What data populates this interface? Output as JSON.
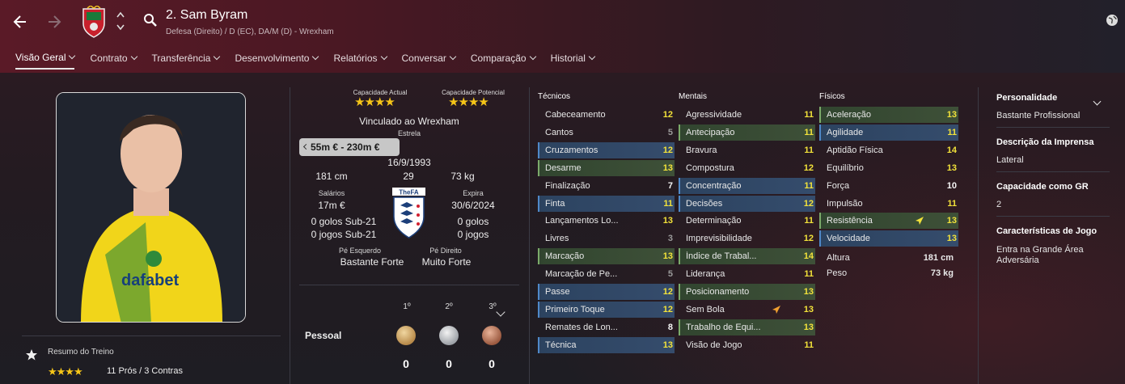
{
  "header": {
    "player_title": "2. Sam Byram",
    "subtitle": "Defesa (Direito) / D (EC), DA/M (D) - Wrexham"
  },
  "tabs": [
    {
      "label": "Visão Geral"
    },
    {
      "label": "Contrato"
    },
    {
      "label": "Transferência"
    },
    {
      "label": "Desenvolvimento"
    },
    {
      "label": "Relatórios"
    },
    {
      "label": "Conversar"
    },
    {
      "label": "Comparação"
    },
    {
      "label": "Historial"
    }
  ],
  "training": {
    "label": "Resumo do Treino",
    "stars": "★★★★",
    "summary": "11 Prós / 3 Contras"
  },
  "info": {
    "cap_actual_label": "Capacidade Actual",
    "cap_actual_stars": "★★★★",
    "cap_potencial_label": "Capacidade Potencial",
    "cap_potencial_stars": "★★★★",
    "contract_status": "Vinculado ao Wrexham",
    "reputation": "Estrela",
    "value": "55m € - 230m €",
    "dob": "16/9/1993",
    "height": "181 cm",
    "age": "29",
    "weight": "73 kg",
    "wage_label": "Salários",
    "wage": "17m €",
    "expires_label": "Expira",
    "expires": "30/6/2024",
    "u21_goals_left": "0 golos Sub-21",
    "u21_games_left": "0 jogos Sub-21",
    "goals_right": "0 golos",
    "games_right": "0 jogos",
    "left_foot_label": "Pé Esquerdo",
    "left_foot": "Bastante Forte",
    "right_foot_label": "Pé Direito",
    "right_foot": "Muito Forte",
    "fa_label": "TheFA"
  },
  "awards": {
    "row_label": "Pessoal",
    "cols": [
      "1º",
      "2º",
      "3º"
    ],
    "values": [
      "0",
      "0",
      "0"
    ]
  },
  "tecnicos": {
    "title": "Técnicos",
    "rows": [
      {
        "label": "Cabeceamento",
        "value": "12"
      },
      {
        "label": "Cantos",
        "value": "5"
      },
      {
        "label": "Cruzamentos",
        "value": "12"
      },
      {
        "label": "Desarme",
        "value": "13"
      },
      {
        "label": "Finalização",
        "value": "7"
      },
      {
        "label": "Finta",
        "value": "11"
      },
      {
        "label": "Lançamentos Lo...",
        "value": "13"
      },
      {
        "label": "Livres",
        "value": "3"
      },
      {
        "label": "Marcação",
        "value": "13"
      },
      {
        "label": "Marcação de Pe...",
        "value": "5"
      },
      {
        "label": "Passe",
        "value": "12"
      },
      {
        "label": "Primeiro Toque",
        "value": "12"
      },
      {
        "label": "Remates de Lon...",
        "value": "8"
      },
      {
        "label": "Técnica",
        "value": "13"
      }
    ]
  },
  "mentais": {
    "title": "Mentais",
    "rows": [
      {
        "label": "Agressividade",
        "value": "11"
      },
      {
        "label": "Antecipação",
        "value": "11"
      },
      {
        "label": "Bravura",
        "value": "11"
      },
      {
        "label": "Compostura",
        "value": "12"
      },
      {
        "label": "Concentração",
        "value": "11"
      },
      {
        "label": "Decisões",
        "value": "12"
      },
      {
        "label": "Determinação",
        "value": "11"
      },
      {
        "label": "Imprevisibilidade",
        "value": "12"
      },
      {
        "label": "Índice de Trabal...",
        "value": "14"
      },
      {
        "label": "Liderança",
        "value": "11"
      },
      {
        "label": "Posicionamento",
        "value": "13"
      },
      {
        "label": "Sem Bola",
        "value": "13"
      },
      {
        "label": "Trabalho de Equi...",
        "value": "13"
      },
      {
        "label": "Visão de Jogo",
        "value": "11"
      }
    ]
  },
  "fisicos": {
    "title": "Físicos",
    "rows": [
      {
        "label": "Aceleração",
        "value": "13"
      },
      {
        "label": "Agilidade",
        "value": "11"
      },
      {
        "label": "Aptidão Física",
        "value": "14"
      },
      {
        "label": "Equilíbrio",
        "value": "13"
      },
      {
        "label": "Força",
        "value": "10"
      },
      {
        "label": "Impulsão",
        "value": "11"
      },
      {
        "label": "Resistência",
        "value": "13"
      },
      {
        "label": "Velocidade",
        "value": "13"
      }
    ],
    "altura_label": "Altura",
    "altura": "181 cm",
    "peso_label": "Peso",
    "peso": "73 kg"
  },
  "right_panel": {
    "personality_label": "Personalidade",
    "personality": "Bastante Profissional",
    "press_label": "Descrição da Imprensa",
    "press": "Lateral",
    "gk_label": "Capacidade como GR",
    "gk": "2",
    "traits_label": "Características de Jogo",
    "traits": "Entra na Grande Área Adversária"
  },
  "colors": {
    "attr_yellow": "#f2e23a",
    "highlight_blue": "#354c6c",
    "highlight_green": "#3e5038",
    "star": "#f5c518"
  }
}
